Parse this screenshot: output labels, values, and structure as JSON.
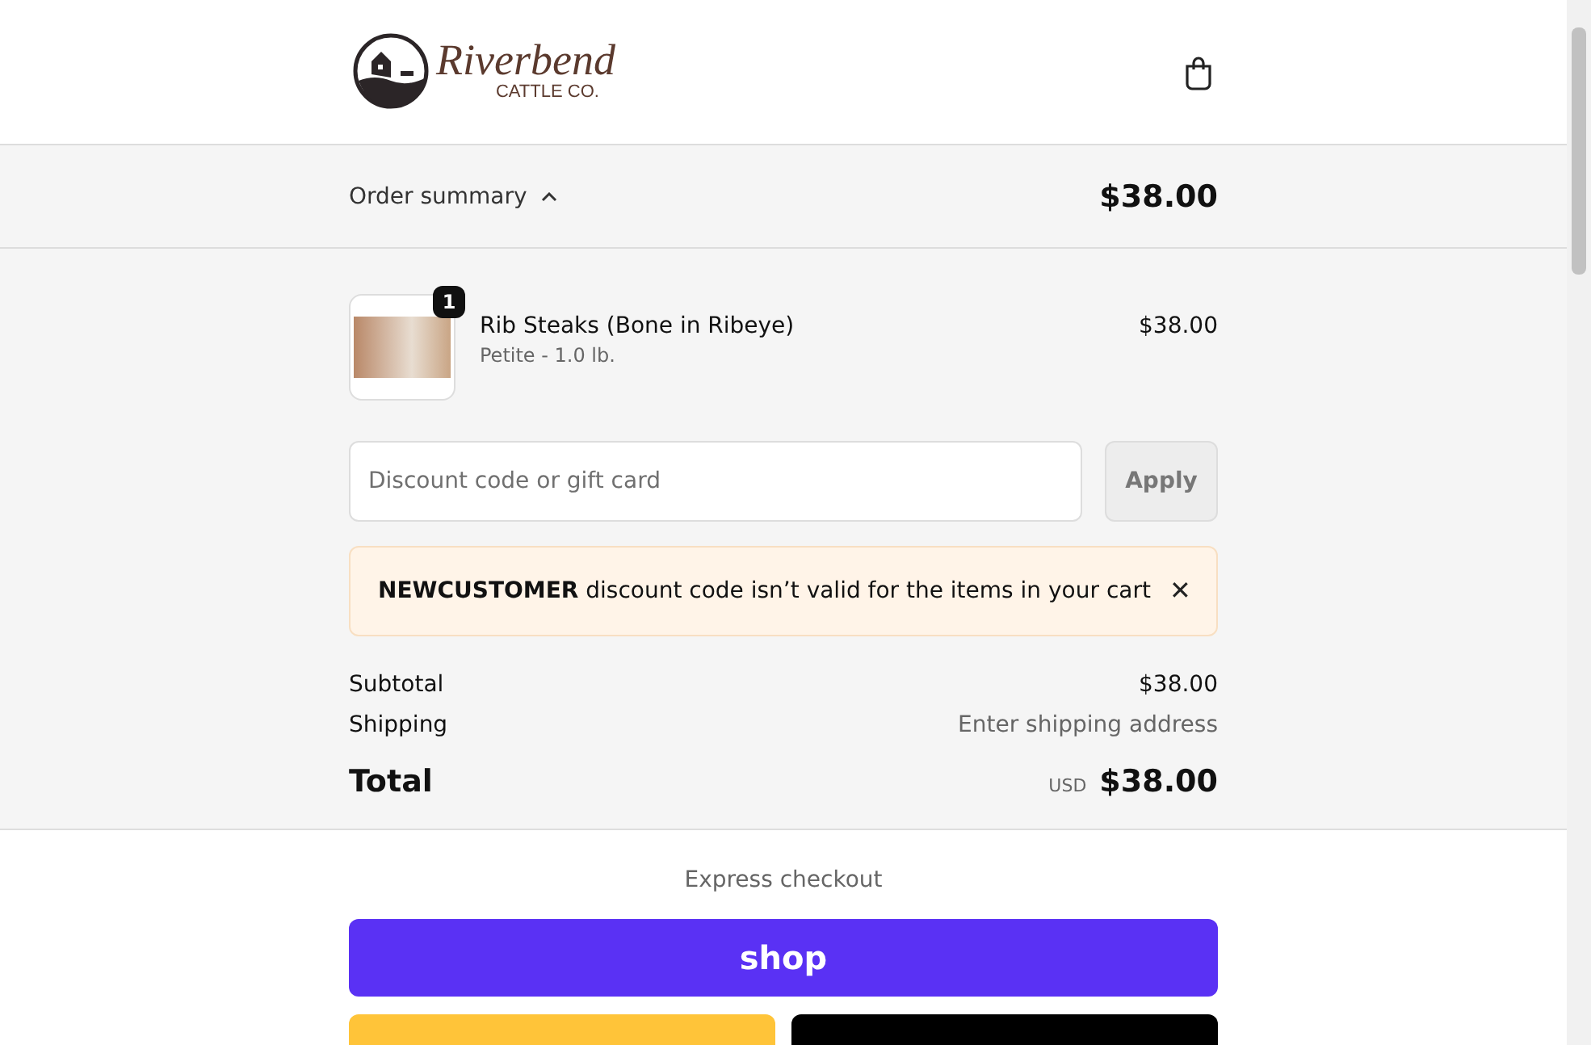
{
  "header": {
    "logo_name": "Riverbend",
    "logo_sub": "CATTLE CO."
  },
  "summary_bar": {
    "label": "Order summary",
    "expanded": true,
    "total": "$38.00"
  },
  "line_items": [
    {
      "title": "Rib Steaks (Bone in Ribeye)",
      "variant": "Petite - 1.0 lb.",
      "quantity": "1",
      "price": "$38.00"
    }
  ],
  "discount": {
    "placeholder": "Discount code or gift card",
    "button": "Apply",
    "disabled": true
  },
  "alert": {
    "message": "**NEWCUSTOMER** discount code isn’t valid for the items in your cart",
    "close": "✕"
  },
  "totals": [
    {
      "label": "Subtotal",
      "value": "$38.00",
      "kind": "amount"
    },
    {
      "label": "Shipping",
      "value": "Enter shipping address",
      "kind": "hint"
    }
  ],
  "grand_total": {
    "label": "Total",
    "currency": "USD",
    "value": "$38.00"
  },
  "express": {
    "heading": "Express checkout",
    "buttons": [
      {
        "kind": "shop",
        "label": "shop"
      },
      {
        "kind": "gold"
      },
      {
        "kind": "dark"
      }
    ]
  }
}
